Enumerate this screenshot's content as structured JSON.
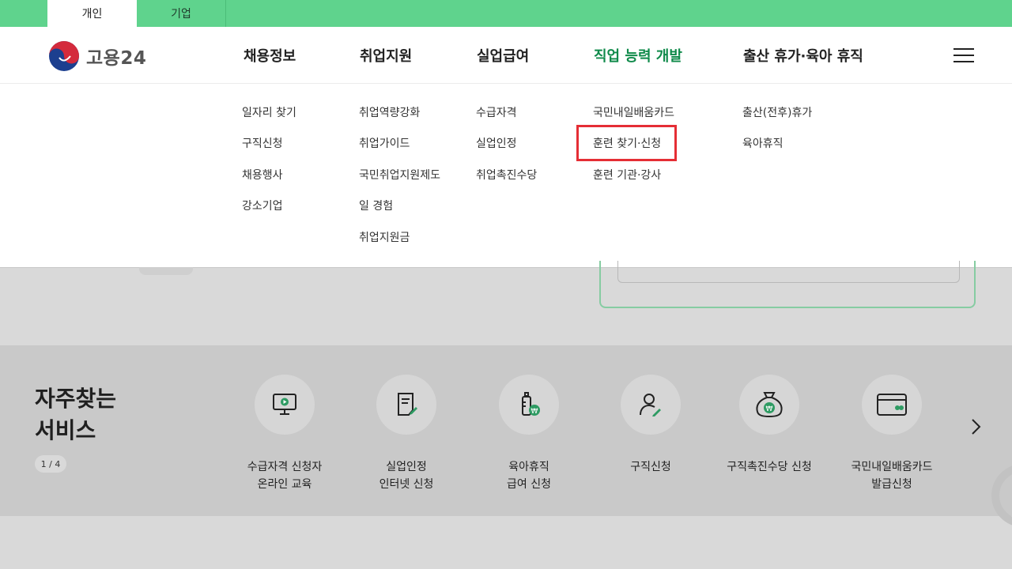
{
  "top_tabs": [
    {
      "label": "개인",
      "active": true
    },
    {
      "label": "기업",
      "active": false
    }
  ],
  "brand": {
    "name": "고용24"
  },
  "gnb": [
    {
      "label": "채용정보"
    },
    {
      "label": "취업지원"
    },
    {
      "label": "실업급여"
    },
    {
      "label": "직업 능력 개발",
      "active": true
    },
    {
      "label": "출산 휴가·육아 휴직"
    }
  ],
  "submenu": {
    "col1": [
      "일자리 찾기",
      "구직신청",
      "채용행사",
      "강소기업"
    ],
    "col2": [
      "취업역량강화",
      "취업가이드",
      "국민취업지원제도",
      "일 경험",
      "취업지원금"
    ],
    "col3": [
      "수급자격",
      "실업인정",
      "취업촉진수당"
    ],
    "col4": [
      "국민내일배움카드",
      "훈련 찾기·신청",
      "훈련 기관·강사"
    ],
    "col5": [
      "출산(전후)휴가",
      "육아휴직"
    ]
  },
  "faq": {
    "title_line1": "자주찾는",
    "title_line2": "서비스",
    "pager": "1 / 4",
    "services": [
      {
        "line1": "수급자격 신청자",
        "line2": "온라인 교육",
        "icon": "monitor-play-icon"
      },
      {
        "line1": "실업인정",
        "line2": "인터넷 신청",
        "icon": "document-pen-icon"
      },
      {
        "line1": "육아휴직",
        "line2": "급여 신청",
        "icon": "baby-bottle-won-icon"
      },
      {
        "line1": "구직신청",
        "line2": "",
        "icon": "person-pen-icon"
      },
      {
        "line1": "구직촉진수당 신청",
        "line2": "",
        "icon": "money-bag-icon"
      },
      {
        "line1": "국민내일배움카드",
        "line2": "발급신청",
        "icon": "card-icon"
      }
    ]
  },
  "colors": {
    "brand_green": "#5fd38d",
    "active_menu": "#0f8a4a",
    "highlight": "#e52e35"
  }
}
